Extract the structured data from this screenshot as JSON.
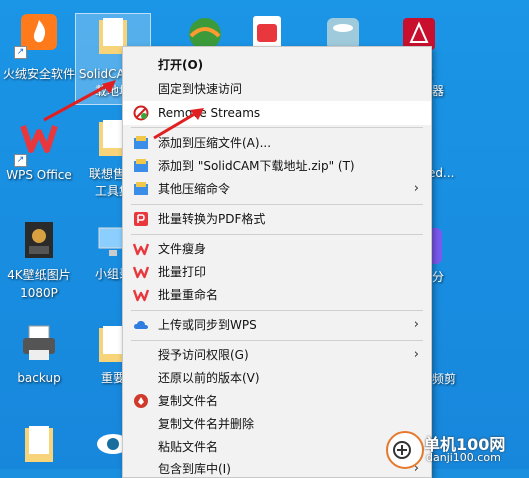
{
  "desktop": {
    "icons": [
      {
        "name": "huorong",
        "label": "火绒安全软件"
      },
      {
        "name": "solidcam",
        "label": "SolidCAM…\n载地址"
      },
      {
        "name": "wps",
        "label": "WPS Office"
      },
      {
        "name": "lenovo",
        "label": "联想售后\n工具集"
      },
      {
        "name": "wallpaper",
        "label": "4K壁纸图片\n1080P"
      },
      {
        "name": "xiaoshi",
        "label": "小组录"
      },
      {
        "name": "backup",
        "label": "backup"
      },
      {
        "name": "zhongyao",
        "label": "重要"
      },
      {
        "name": "right1",
        "label": "成\n换器"
      },
      {
        "name": "right2",
        "label": "ed..."
      },
      {
        "name": "right3",
        "label": "分"
      },
      {
        "name": "right4",
        "label": "频剪"
      }
    ]
  },
  "menu": {
    "items": [
      {
        "label": "打开(O)"
      },
      {
        "label": "固定到快速访问"
      },
      {
        "label": "Remove Streams"
      },
      {
        "label": "添加到压缩文件(A)..."
      },
      {
        "label": "添加到 \"SolidCAM下载地址.zip\" (T)"
      },
      {
        "label": "其他压缩命令",
        "arrow": "›"
      },
      {
        "label": "批量转换为PDF格式"
      },
      {
        "label": "文件瘦身"
      },
      {
        "label": "批量打印"
      },
      {
        "label": "批量重命名"
      },
      {
        "label": "上传或同步到WPS",
        "arrow": "›"
      },
      {
        "label": "授予访问权限(G)",
        "arrow": "›"
      },
      {
        "label": "还原以前的版本(V)"
      },
      {
        "label": "复制文件名"
      },
      {
        "label": "复制文件名并删除"
      },
      {
        "label": "粘贴文件名"
      },
      {
        "label": "包含到库中(I)",
        "arrow": "›"
      }
    ]
  },
  "watermark": {
    "line1": "单机100网",
    "line2": "danji100.com"
  },
  "colors": {
    "desktop": "#1a8fe0",
    "menu_bg": "#f2f2f2",
    "arrow_red": "#e02020",
    "wps_red": "#e8383d"
  }
}
